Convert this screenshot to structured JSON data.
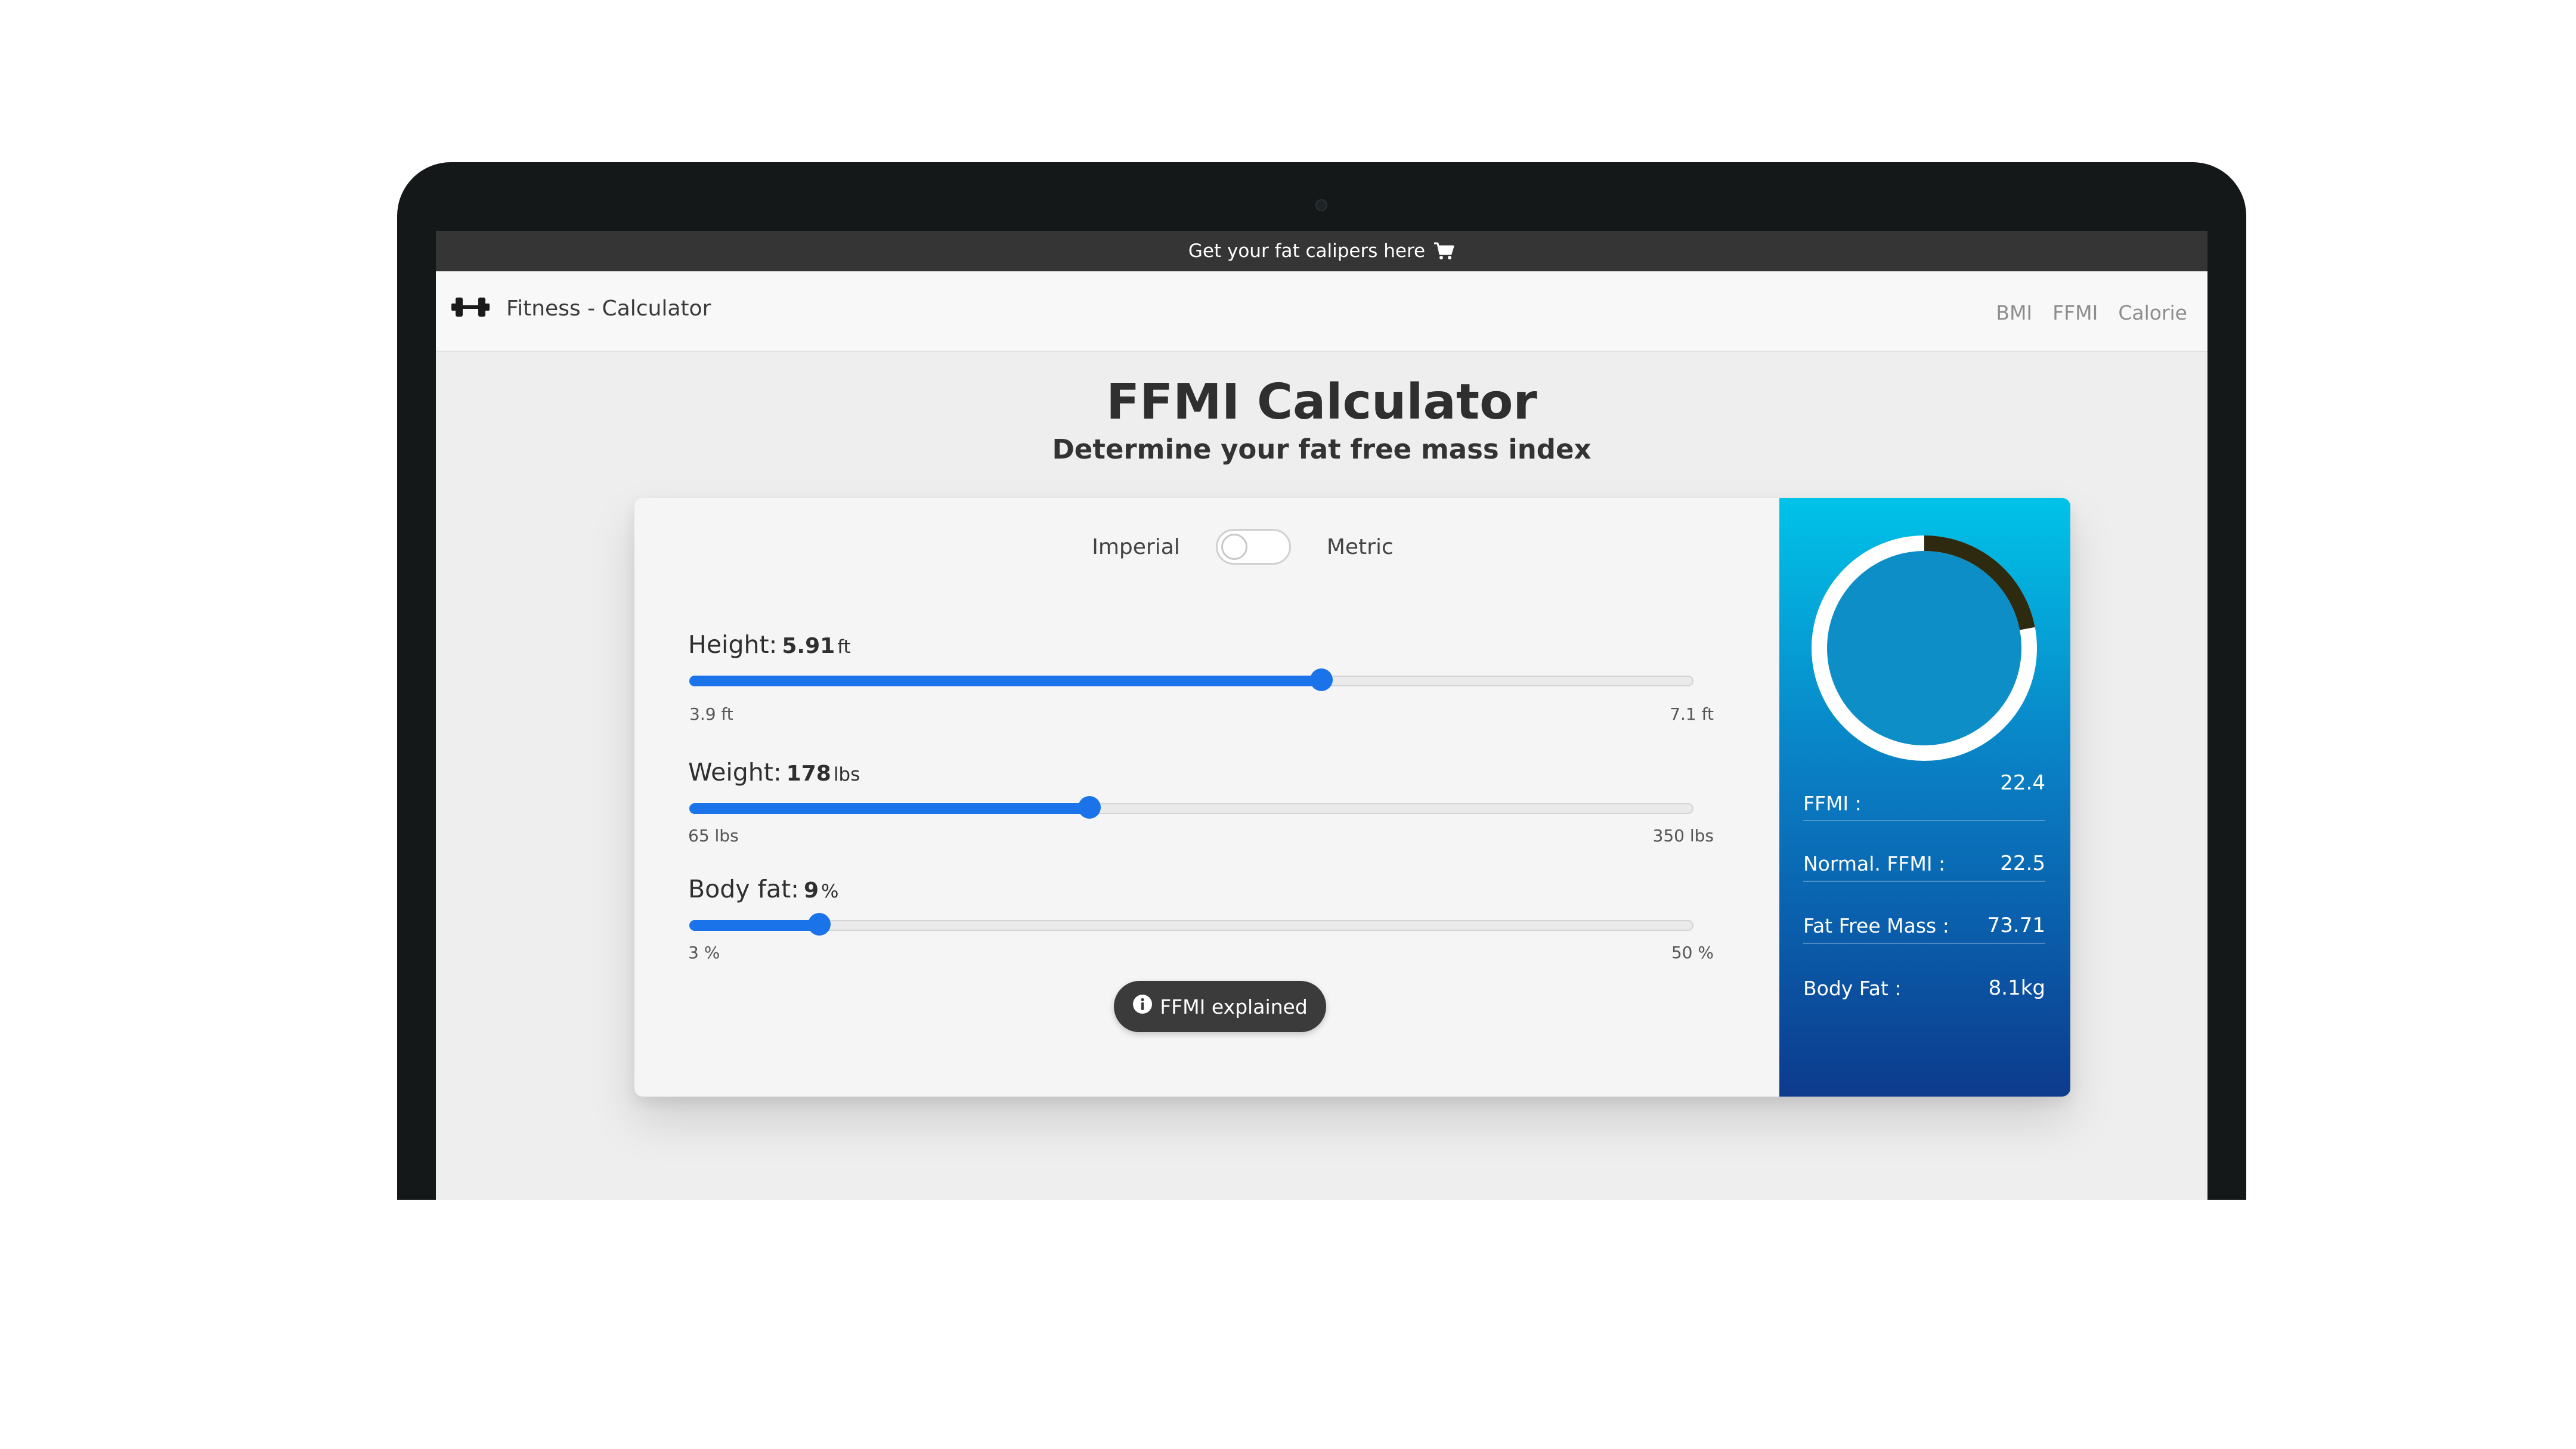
{
  "promo": {
    "text": "Get your fat calipers here",
    "icon": "cart-icon"
  },
  "nav": {
    "brand": "Fitness - Calculator",
    "brand_icon": "dumbbell-icon",
    "links": [
      "BMI",
      "FFMI",
      "Calorie"
    ]
  },
  "page": {
    "title": "FFMI Calculator",
    "subtitle": "Determine your fat free mass index"
  },
  "units": {
    "left": "Imperial",
    "right": "Metric",
    "metric_on": false
  },
  "sliders": [
    {
      "label": "Height:",
      "value": "5.91",
      "unit": "ft",
      "min": "3.9 ft",
      "max": "7.1 ft",
      "fraction": 0.628
    },
    {
      "label": "Weight:",
      "value": "178",
      "unit": "lbs",
      "min": "65 lbs",
      "max": "350 lbs",
      "fraction": 0.397
    },
    {
      "label": "Body fat:",
      "value": "9",
      "unit": "%",
      "min": "3 %",
      "max": "50 %",
      "fraction": 0.128
    }
  ],
  "explain_button": "FFMI explained",
  "results": {
    "gauge_fraction": 0.22,
    "colors": {
      "accent": "#1a73e8",
      "gauge_arc": "#2d2a10",
      "gauge_ring": "#ffffff"
    },
    "rows": [
      {
        "label": "FFMI :",
        "value": "22.4"
      },
      {
        "label": "Normal. FFMI :",
        "value": "22.5"
      },
      {
        "label": "Fat Free Mass :",
        "value": "73.71"
      },
      {
        "label": "Body Fat :",
        "value": "8.1kg"
      }
    ]
  }
}
